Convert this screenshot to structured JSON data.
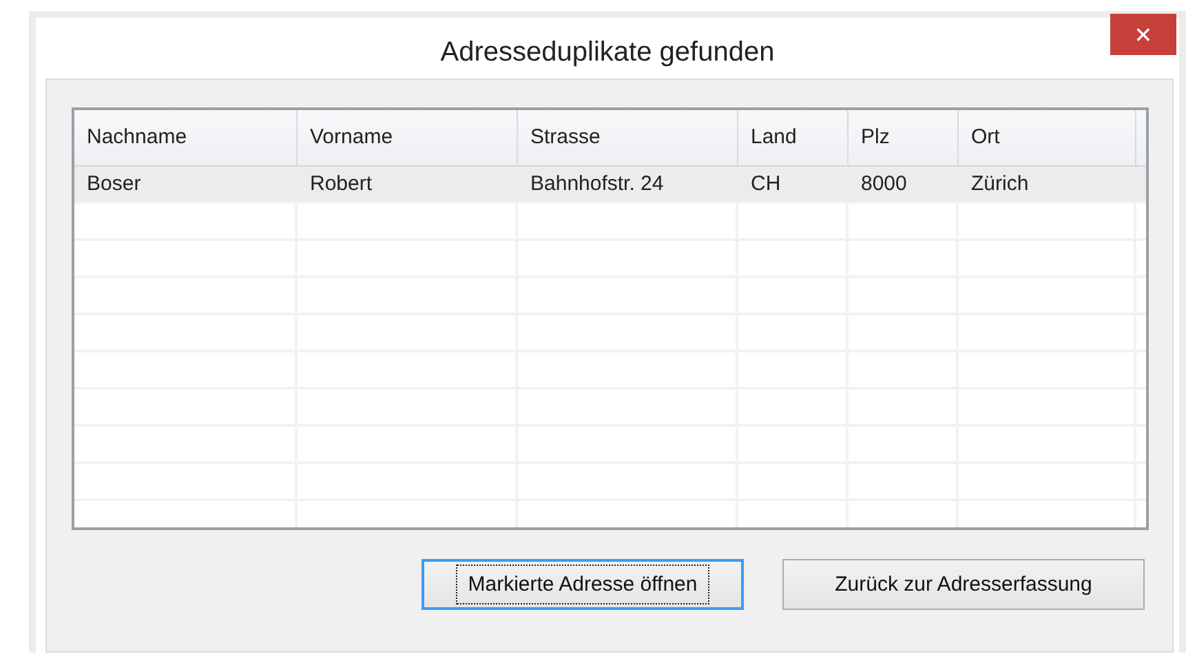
{
  "window": {
    "title": "Adresseduplikate gefunden",
    "close_label": "✕"
  },
  "table": {
    "columns": [
      "Nachname",
      "Vorname",
      "Strasse",
      "Land",
      "Plz",
      "Ort"
    ],
    "rows": [
      {
        "cells": [
          "Boser",
          "Robert",
          "Bahnhofstr. 24",
          "CH",
          "8000",
          "Zürich"
        ],
        "selected": true
      }
    ]
  },
  "buttons": [
    {
      "label": "Markierte Adresse öffnen",
      "focused": true
    },
    {
      "label": "Zurück zur Adresserfassung",
      "focused": false
    }
  ]
}
